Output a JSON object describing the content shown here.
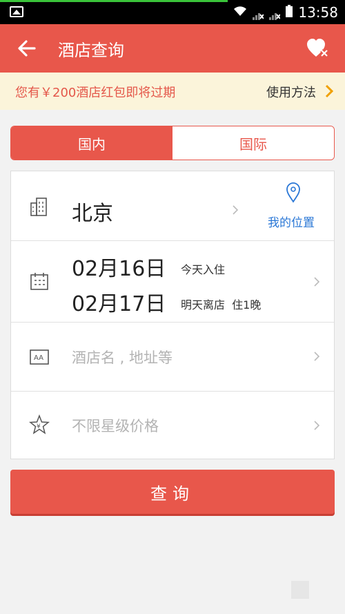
{
  "status_bar": {
    "time": "13:58"
  },
  "header": {
    "title": "酒店查询"
  },
  "notice": {
    "message": "您有￥200酒店红包即将过期",
    "action": "使用方法"
  },
  "tabs": [
    {
      "label": "国内",
      "active": true
    },
    {
      "label": "国际",
      "active": false
    }
  ],
  "form": {
    "city": "北京",
    "my_location": "我的位置",
    "checkin_date": "02月16日",
    "checkin_note": "今天入住",
    "checkout_date": "02月17日",
    "checkout_note": "明天离店  住1晚",
    "hotel_placeholder": "酒店名 , 地址等",
    "star_price_placeholder": "不限星级价格"
  },
  "search_button": {
    "label": "查询"
  },
  "colors": {
    "accent": "#e8574b",
    "notice_bg": "#fbf4da",
    "link_blue": "#2a77d6"
  }
}
